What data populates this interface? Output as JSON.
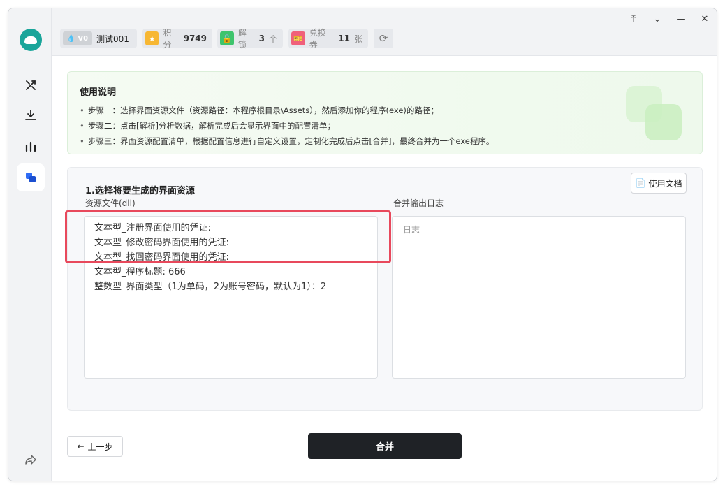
{
  "window_controls": {
    "pin": "⤒",
    "collapse": "⌄",
    "minimize": "—",
    "close": "✕"
  },
  "header": {
    "user": {
      "badge": "V0",
      "name": "测试001"
    },
    "points": {
      "label": "积分",
      "value": "9749"
    },
    "unlock": {
      "label": "解锁",
      "value": "3",
      "unit": "个"
    },
    "coupon": {
      "label": "兑换券",
      "value": "11",
      "unit": "张"
    }
  },
  "sidebar": {
    "items": [
      "tools-icon",
      "download-icon",
      "stats-icon",
      "merge-icon"
    ],
    "active": 3
  },
  "instructions": {
    "title": "使用说明",
    "steps": [
      "步骤一：选择界面资源文件（资源路径：本程序根目录\\Assets），然后添加你的程序(exe)的路径；",
      "步骤二：点击[解析]分析数据，解析完成后会显示界面中的配置清单；",
      "步骤三：界面资源配置清单，根据配置信息进行自定义设置，定制化完成后点击[合并]，最终合并为一个exe程序。"
    ]
  },
  "panel": {
    "title": "1.选择将要生成的界面资源",
    "doc_button": "使用文档",
    "resource_label": "资源文件(dll)",
    "log_label": "合并输出日志",
    "log_placeholder": "日志",
    "resource_lines": [
      "文本型_注册界面使用的凭证:",
      "文本型_修改密码界面使用的凭证:",
      "文本型_找回密码界面使用的凭证:",
      "文本型_程序标题: 666",
      "整数型_界面类型（1为单码，2为账号密码，默认为1）：2"
    ]
  },
  "footer": {
    "prev_button": "上一步",
    "merge_button": "合并"
  },
  "colors": {
    "accent_red": "#e8495c",
    "dark_button": "#1f2226",
    "brand": "#1aa59a"
  }
}
